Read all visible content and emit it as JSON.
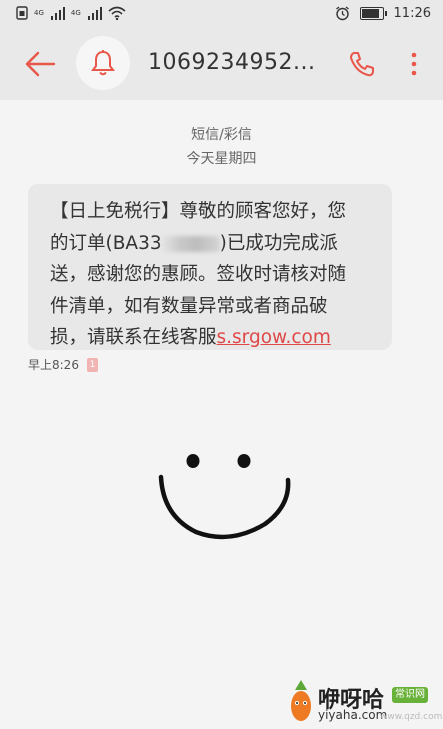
{
  "status_bar": {
    "sim1_tag": "4G",
    "sim2_tag": "4G",
    "time": "11:26",
    "battery_level": 0.9,
    "icons": [
      "sim-icon",
      "signal-icon",
      "wifi-icon",
      "alarm-icon",
      "battery-icon"
    ]
  },
  "header": {
    "title": "1069234952...",
    "accent_color": "#e8574a",
    "icons": [
      "back-arrow-icon",
      "bell-icon",
      "phone-icon",
      "more-vert-icon"
    ]
  },
  "conversation": {
    "channel_label": "短信/彩信",
    "date_label": "今天星期四",
    "message": {
      "line1": "【日上免税行】尊敬的顾客您好，您",
      "line2_prefix": "的订单(BA33",
      "line2_suffix": ")已成功完成派",
      "line3": "送，感谢您的惠顾。签收时请核对随",
      "line4": "件清单，如有数量异常或者商品破",
      "line5_prefix": "损，请联系在线客服",
      "link_text": "s.srgow.com"
    },
    "timestamp": "早上8:26",
    "sim_badge": "1"
  },
  "watermark": {
    "brand": "咿呀哈",
    "badge": "常识网",
    "url": "yiyaha.com",
    "url_faint": "www.qzd.com"
  }
}
